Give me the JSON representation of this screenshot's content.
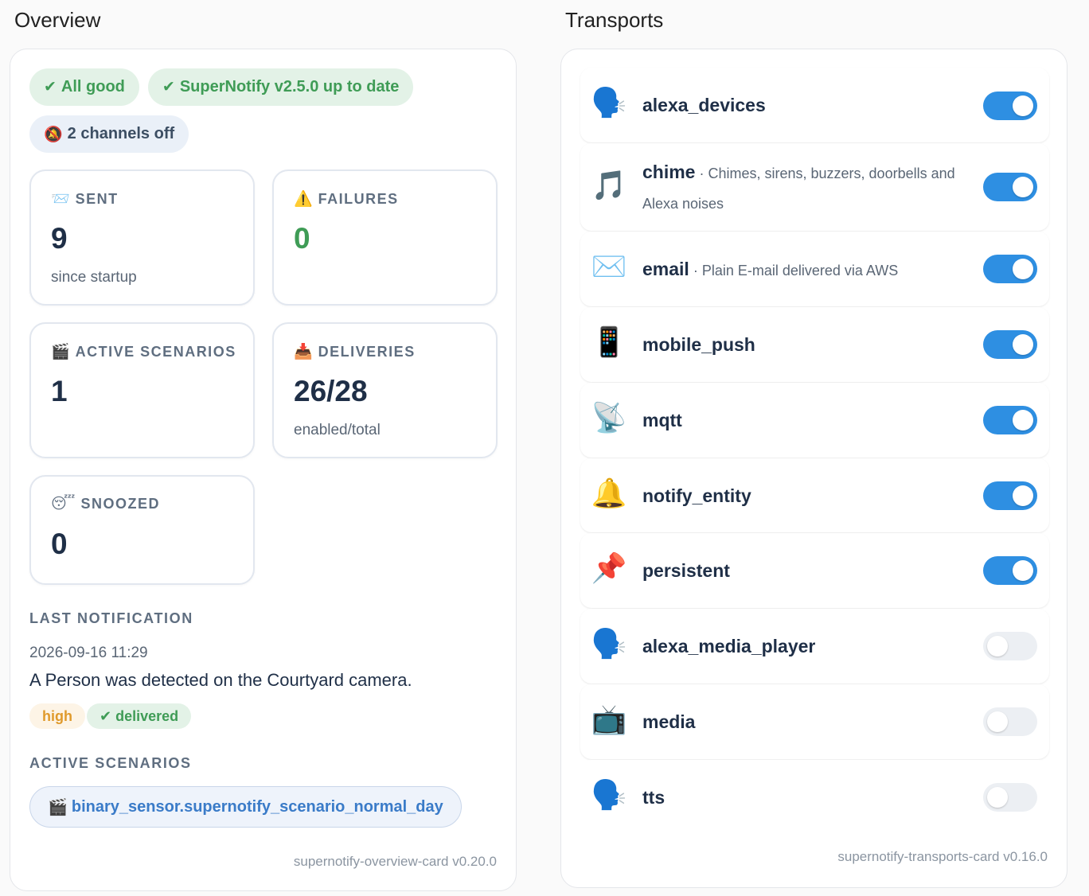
{
  "overview": {
    "title": "Overview",
    "chips": [
      {
        "icon": "✔",
        "label": "All good",
        "style": "good"
      },
      {
        "icon": "✔",
        "label": "SuperNotify v2.5.0 up to date",
        "style": "good"
      },
      {
        "icon": "🔕",
        "label": "2 channels off",
        "style": "info"
      }
    ],
    "stats": {
      "sent": {
        "icon": "📨",
        "label": "SENT",
        "value": "9",
        "sub": "since startup"
      },
      "failures": {
        "icon": "⚠️",
        "label": "FAILURES",
        "value": "0",
        "sub": ""
      },
      "active_scenarios": {
        "icon": "🎬",
        "label": "ACTIVE SCENARIOS",
        "value": "1",
        "sub": ""
      },
      "deliveries": {
        "icon": "📥",
        "label": "DELIVERIES",
        "value": "26/28",
        "sub": "enabled/total"
      },
      "snoozed": {
        "icon": "😴",
        "label": "SNOOZED",
        "value": "0",
        "sub": ""
      }
    },
    "last_notification": {
      "heading": "LAST NOTIFICATION",
      "timestamp": "2026-09-16 11:29",
      "message": "A Person was detected on the Courtyard camera.",
      "priority": "high",
      "status": "✔ delivered"
    },
    "active_scenarios": {
      "heading": "ACTIVE SCENARIOS",
      "items": [
        {
          "icon": "🎬",
          "label": "binary_sensor.supernotify_scenario_normal_day"
        }
      ]
    },
    "footer": "supernotify-overview-card v0.20.0"
  },
  "transports": {
    "title": "Transports",
    "items": [
      {
        "icon": "🗣️",
        "name": "alexa_devices",
        "description": "",
        "enabled": true
      },
      {
        "icon": "🎵",
        "name": "chime",
        "description": "Chimes, sirens, buzzers, doorbells and Alexa noises",
        "enabled": true
      },
      {
        "icon": "✉️",
        "name": "email",
        "description": "Plain E-mail delivered via AWS",
        "enabled": true
      },
      {
        "icon": "📱",
        "name": "mobile_push",
        "description": "",
        "enabled": true
      },
      {
        "icon": "📡",
        "name": "mqtt",
        "description": "",
        "enabled": true
      },
      {
        "icon": "🔔",
        "name": "notify_entity",
        "description": "",
        "enabled": true
      },
      {
        "icon": "📌",
        "name": "persistent",
        "description": "",
        "enabled": true
      },
      {
        "icon": "🗣️",
        "name": "alexa_media_player",
        "description": "",
        "enabled": false
      },
      {
        "icon": "📺",
        "name": "media",
        "description": "",
        "enabled": false
      },
      {
        "icon": "🗣️",
        "name": "tts",
        "description": "",
        "enabled": false
      }
    ],
    "footer": "supernotify-transports-card v0.16.0"
  },
  "colors": {
    "accent_blue": "#2e8fe2",
    "good_green": "#3f9c56",
    "warn_orange": "#e09a2c",
    "link_blue": "#3a7bc8"
  }
}
